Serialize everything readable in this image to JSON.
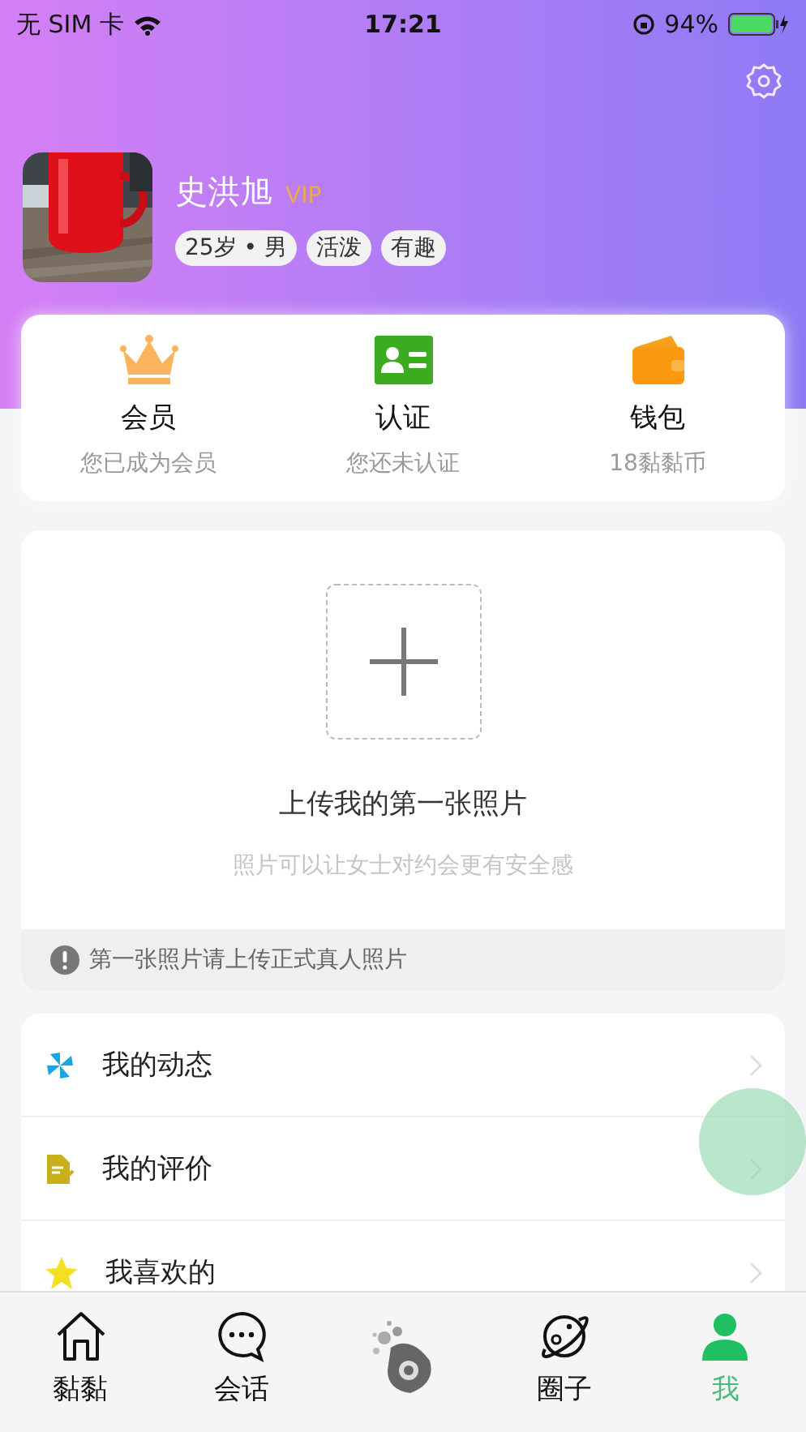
{
  "status_bar": {
    "carrier": "无 SIM 卡",
    "time": "17:21",
    "battery": "94%"
  },
  "profile": {
    "name": "史洪旭",
    "badge": "VIP",
    "tags": [
      "25岁 • 男",
      "活泼",
      "有趣"
    ]
  },
  "stats": [
    {
      "title": "会员",
      "subtitle": "您已成为会员"
    },
    {
      "title": "认证",
      "subtitle": "您还未认证"
    },
    {
      "title": "钱包",
      "subtitle": "18黏黏币"
    }
  ],
  "photo_upload": {
    "title": "上传我的第一张照片",
    "subtitle": "照片可以让女士对约会更有安全感",
    "notice": "第一张照片请上传正式真人照片"
  },
  "menu": [
    {
      "label": "我的动态"
    },
    {
      "label": "我的评价"
    },
    {
      "label": "我喜欢的"
    }
  ],
  "tab_bar": [
    {
      "kind": "home",
      "label": "黏黏",
      "selected": false
    },
    {
      "kind": "chat",
      "label": "会话",
      "selected": false
    },
    {
      "kind": "logo",
      "selected": false
    },
    {
      "kind": "planet",
      "label": "圈子",
      "selected": false
    },
    {
      "kind": "person",
      "label": "我",
      "selected": true
    }
  ]
}
